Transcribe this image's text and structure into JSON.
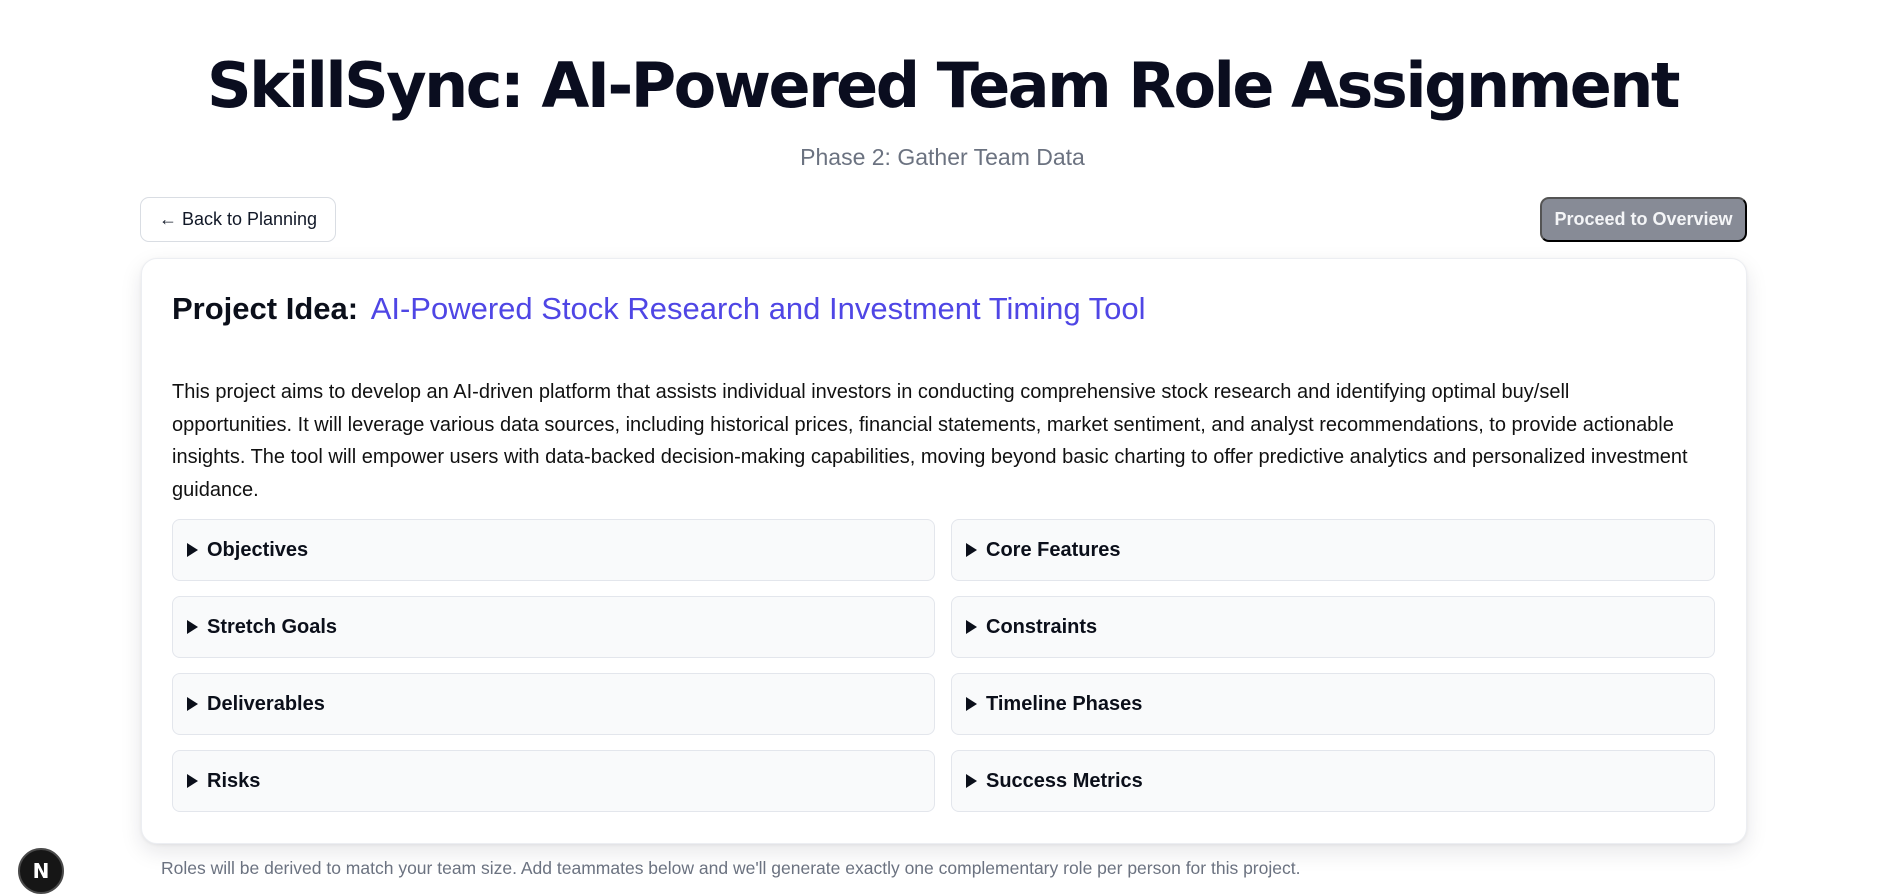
{
  "header": {
    "title": "SkillSync: AI-Powered Team Role Assignment",
    "subtitle": "Phase 2: Gather Team Data"
  },
  "nav": {
    "back_label": "← Back to Planning",
    "proceed_label": "Proceed to Overview"
  },
  "project": {
    "label": "Project Idea:",
    "name": "AI-Powered Stock Research and Investment Timing Tool",
    "description": "This project aims to develop an AI-driven platform that assists individual investors in conducting comprehensive stock research and identifying optimal buy/sell opportunities. It will leverage various data sources, including historical prices, financial statements, market sentiment, and analyst recommendations, to provide actionable insights. The tool will empower users with data-backed decision-making capabilities, moving beyond basic charting to offer predictive analytics and personalized investment guidance.",
    "sections": [
      {
        "label": "Objectives"
      },
      {
        "label": "Core Features"
      },
      {
        "label": "Stretch Goals"
      },
      {
        "label": "Constraints"
      },
      {
        "label": "Deliverables"
      },
      {
        "label": "Timeline Phases"
      },
      {
        "label": "Risks"
      },
      {
        "label": "Success Metrics"
      }
    ]
  },
  "note": "Roles will be derived to match your team size. Add teammates below and we'll generate exactly one complementary role per person for this project.",
  "badge": {
    "letter": "N"
  },
  "colors": {
    "accent": "#4f46e5",
    "proceed_button": "#878b96",
    "muted_text": "#6b7280"
  }
}
